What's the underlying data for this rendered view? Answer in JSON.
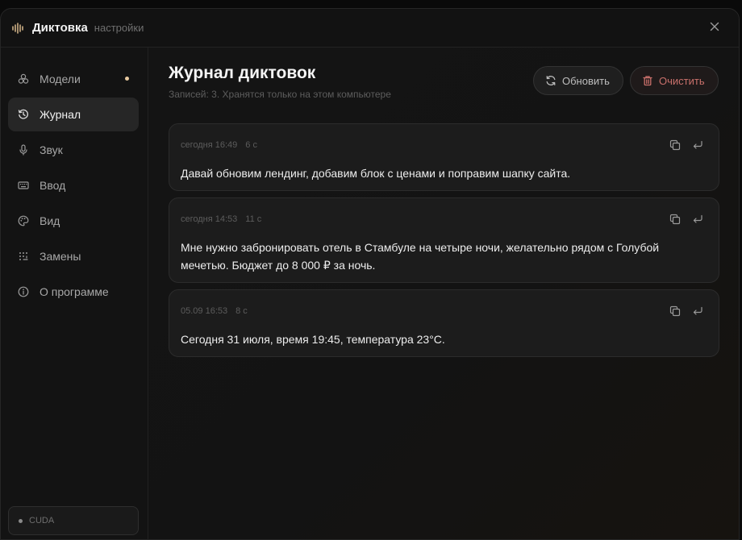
{
  "titlebar": {
    "title": "Диктовка",
    "subtitle": "настройки"
  },
  "sidebar": {
    "items": [
      {
        "label": "Модели",
        "icon": "models-icon"
      },
      {
        "label": "Журнал",
        "icon": "history-icon"
      },
      {
        "label": "Звук",
        "icon": "microphone-icon"
      },
      {
        "label": "Ввод",
        "icon": "keyboard-icon"
      },
      {
        "label": "Вид",
        "icon": "palette-icon"
      },
      {
        "label": "Замены",
        "icon": "replace-icon"
      },
      {
        "label": "О программе",
        "icon": "info-icon"
      }
    ],
    "active_index": 1,
    "status": "CUDA"
  },
  "main": {
    "title": "Журнал диктовок",
    "subtitle": "Записей: 3. Хранятся только на этом компьютере",
    "refresh_label": "Обновить",
    "clear_label": "Очистить",
    "entries": [
      {
        "time": "сегодня 16:49",
        "duration": "6 с",
        "text": "Давай обновим лендинг, добавим блок с ценами и поправим шапку сайта."
      },
      {
        "time": "сегодня 14:53",
        "duration": "11 с",
        "text": "Мне нужно забронировать отель в Стамбуле на четыре ночи, желательно рядом с Голубой мечетью. Бюджет до 8 000 ₽ за ночь."
      },
      {
        "time": "05.09 16:53",
        "duration": "8 с",
        "text": "Сегодня 31 июля, время 19:45, температура 23°C."
      }
    ]
  },
  "colors": {
    "accent_dot": "#e8c9a0",
    "danger": "#c9706b"
  }
}
